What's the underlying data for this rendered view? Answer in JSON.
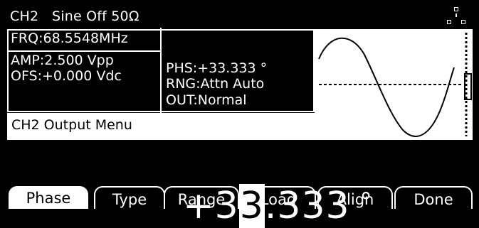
{
  "header": {
    "title": "CH2   Sine Off 50Ω",
    "icon": "network-icon"
  },
  "info": {
    "frequency": "FRQ:68.5548MHz",
    "amplitude": "AMP:2.500 Vpp",
    "offset": "OFS:+0.000 Vdc",
    "phase": "PHS:+33.333 °",
    "range": "RNG:Attn Auto",
    "output": "OUT:Normal"
  },
  "menu_title": "CH2 Output Menu",
  "big_value": {
    "sign": "+",
    "digit_before": "3",
    "cursor_digit": "3",
    "rest": ".333",
    "unit": "°"
  },
  "softkeys": [
    {
      "label": "Phase",
      "active": true
    },
    {
      "label": "Type",
      "active": false
    },
    {
      "label": "Range",
      "active": false
    },
    {
      "label": "Load",
      "active": false
    },
    {
      "label": "Align",
      "active": false
    },
    {
      "label": "Done",
      "active": false
    }
  ],
  "colors": {
    "background": "#000000",
    "foreground": "#ffffff"
  }
}
